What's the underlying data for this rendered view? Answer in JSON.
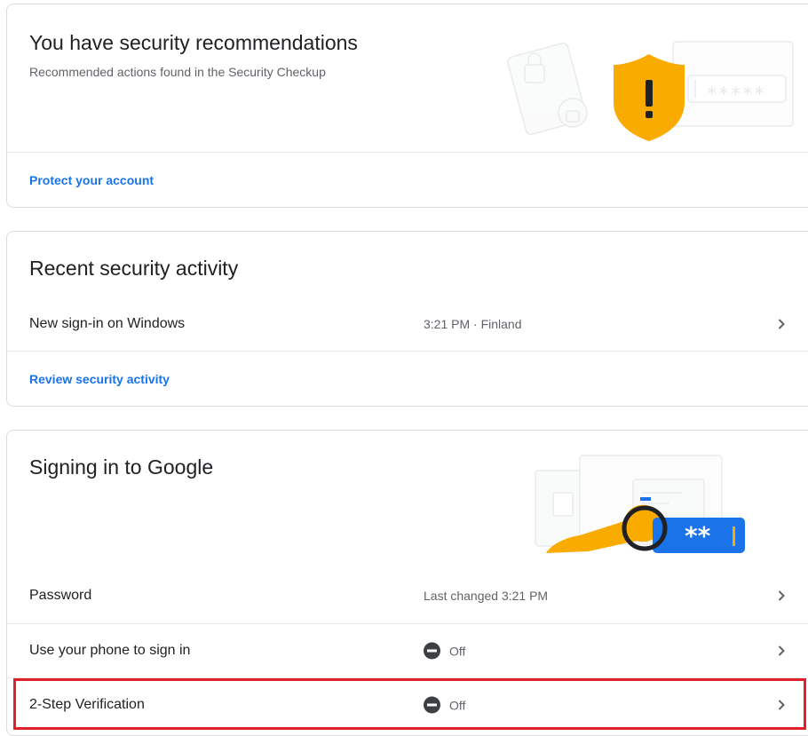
{
  "recommendations": {
    "title": "You have security recommendations",
    "subtitle": "Recommended actions found in the Security Checkup",
    "link": "Protect your account"
  },
  "activity": {
    "title": "Recent security activity",
    "rows": [
      {
        "label": "New sign-in on Windows",
        "value": "3:21 PM · Finland"
      }
    ],
    "link": "Review security activity"
  },
  "signin": {
    "title": "Signing in to Google",
    "rows": [
      {
        "label": "Password",
        "value": "Last changed 3:21 PM"
      },
      {
        "label": "Use your phone to sign in",
        "value": "Off"
      },
      {
        "label": "2-Step Verification",
        "value": "Off"
      }
    ],
    "password_mask": "**"
  },
  "icons": {
    "shield": "shield-warning-icon",
    "off": "off-status-icon",
    "chevron": "chevron-right-icon",
    "key": "key-illustration"
  },
  "colors": {
    "link_blue": "#1a73e8",
    "shield_yellow": "#f9ab00",
    "highlight_red": "#e0202a",
    "password_blue": "#1a73e8"
  }
}
